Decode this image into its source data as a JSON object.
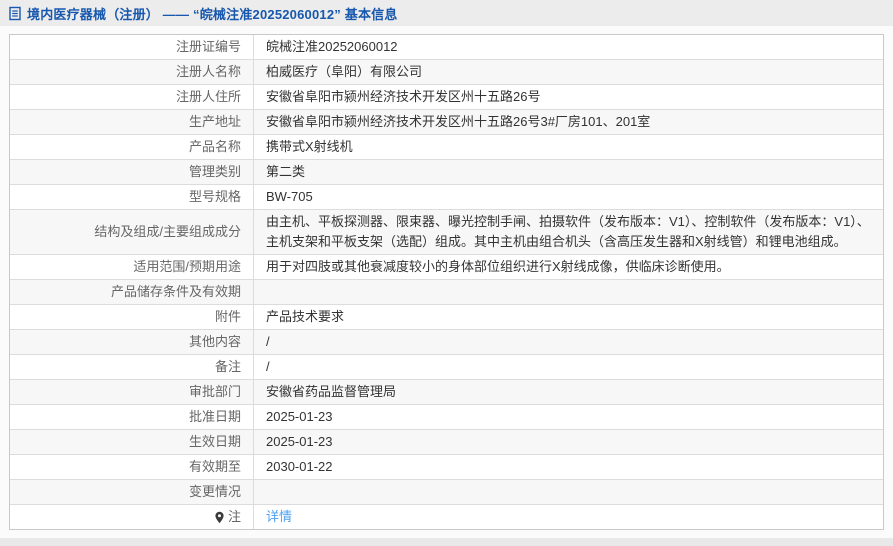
{
  "page": {
    "title": "境内医疗器械（注册） —— “皖械注准20252060012” 基本信息",
    "colors": {
      "accent": "#1757ad",
      "link": "#4d9ff0",
      "row_alt_bg": "#f7f7f7",
      "border": "#c9c9c9"
    },
    "icons": {
      "title_icon": "document-icon",
      "note_icon": "pin-icon"
    }
  },
  "table": {
    "rows": [
      {
        "label": "注册证编号",
        "value": "皖械注准20252060012"
      },
      {
        "label": "注册人名称",
        "value": "柏威医疗（阜阳）有限公司"
      },
      {
        "label": "注册人住所",
        "value": "安徽省阜阳市颍州经济技术开发区州十五路26号"
      },
      {
        "label": "生产地址",
        "value": "安徽省阜阳市颍州经济技术开发区州十五路26号3#厂房101、201室"
      },
      {
        "label": "产品名称",
        "value": "携带式X射线机"
      },
      {
        "label": "管理类别",
        "value": "第二类"
      },
      {
        "label": "型号规格",
        "value": "BW-705"
      },
      {
        "label": "结构及组成/主要组成成分",
        "value": "由主机、平板探测器、限束器、曝光控制手闸、拍摄软件（发布版本：V1）、控制软件（发布版本：V1）、主机支架和平板支架（选配）组成。其中主机由组合机头（含高压发生器和X射线管）和锂电池组成。"
      },
      {
        "label": "适用范围/预期用途",
        "value": "用于对四肢或其他衰减度较小的身体部位组织进行X射线成像，供临床诊断使用。"
      },
      {
        "label": "产品储存条件及有效期",
        "value": ""
      },
      {
        "label": "附件",
        "value": "产品技术要求"
      },
      {
        "label": "其他内容",
        "value": "/"
      },
      {
        "label": "备注",
        "value": "/"
      },
      {
        "label": "审批部门",
        "value": "安徽省药品监督管理局"
      },
      {
        "label": "批准日期",
        "value": "2025-01-23"
      },
      {
        "label": "生效日期",
        "value": "2025-01-23"
      },
      {
        "label": "有效期至",
        "value": "2030-01-22"
      },
      {
        "label": "变更情况",
        "value": ""
      },
      {
        "label": "注",
        "label_icon": "pin-icon",
        "value": "详情",
        "value_type": "link"
      }
    ]
  }
}
